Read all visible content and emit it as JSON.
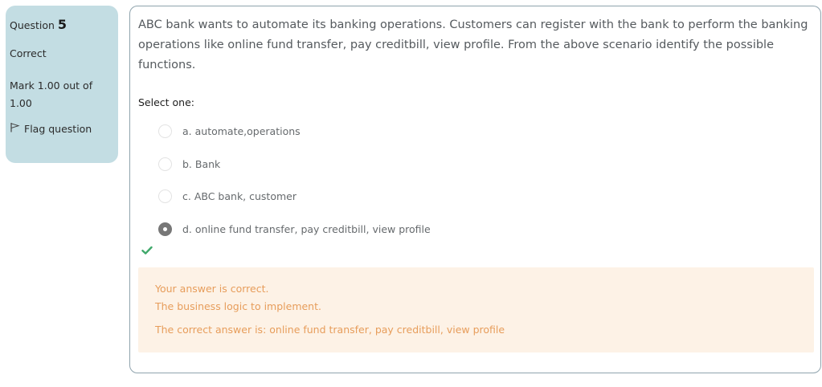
{
  "info": {
    "question_label": "Question",
    "question_number": "5",
    "state": "Correct",
    "grade": "Mark 1.00 out of 1.00",
    "flag_label": "Flag question",
    "flag_icon": "flag-icon"
  },
  "question": {
    "text": "ABC bank wants to automate its banking operations. Customers can register with the bank to perform the banking operations like online fund transfer, pay creditbill, view profile. From the above scenario identify the possible functions.",
    "prompt": "Select one:",
    "options": [
      {
        "label": "a. automate,operations",
        "selected": false
      },
      {
        "label": "b. Bank",
        "selected": false
      },
      {
        "label": "c. ABC bank, customer",
        "selected": false
      },
      {
        "label": "d. online fund transfer, pay creditbill, view profile",
        "selected": true
      }
    ],
    "result_icon": "checkmark-icon"
  },
  "feedback": {
    "result": "Your answer is correct.",
    "general": "The business logic to implement.",
    "correct_answer": "The correct answer is: online fund transfer, pay creditbill, view profile"
  },
  "colors": {
    "info_bg": "#c3dde3",
    "feedback_bg": "#fdf2e6",
    "feedback_text": "#e79d5b",
    "check_green": "#3fa86a"
  }
}
